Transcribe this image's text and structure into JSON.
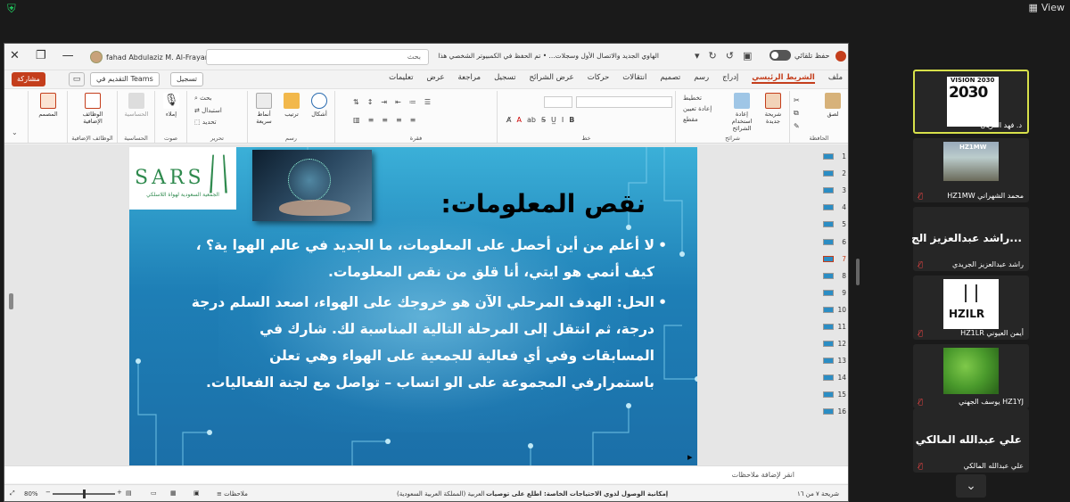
{
  "zoom": {
    "view_label": "View"
  },
  "ppt": {
    "user_name": "fahad Abdulaziz M. Al-Frayan",
    "search_placeholder": "بحث",
    "doc_title": "الهاوي الجديد والاتصال الأول وسجلات... • تم الحفظ في الكمبيوتر الشخصي هذا",
    "autosave_label": "حفظ تلقائي",
    "tabs": [
      "ملف",
      "الشريط الرئيسي",
      "إدراج",
      "رسم",
      "تصميم",
      "انتقالات",
      "حركات",
      "عرض الشرائح",
      "تسجيل",
      "مراجعة",
      "عرض",
      "تعليمات"
    ],
    "active_tab": "الشريط الرئيسي",
    "share_label": "مشاركة",
    "teams_label": "التقديم في Teams",
    "record_label": "تسجيل",
    "groups": {
      "clipboard": "الحافظة",
      "slides": "شرائح",
      "font": "خط",
      "paragraph": "فقرة",
      "drawing": "رسم",
      "editing": "تحرير",
      "voice": "صوت",
      "sensitivity": "الحساسية",
      "addins": "الوظائف الإضافية"
    },
    "buttons": {
      "paste": "لصق",
      "new_slide": "شريحة جديدة",
      "reuse_slides": "إعادة استخدام الشرائح",
      "layout": "تخطيط",
      "reset": "إعادة تعيين",
      "section": "مقطع",
      "shapes": "أشكال",
      "arrange": "ترتيب",
      "quick_styles": "أنماط سريعة",
      "find": "بحث",
      "replace": "استبدال",
      "select": "تحديد",
      "dictate": "إملاء",
      "sensitivity": "الحساسية",
      "addins": "الوظائف الإضافية",
      "designer": "المصمم"
    },
    "slide": {
      "logo_text": "SARS",
      "logo_sub": "الجمعية السعودية لهواة اللاسلكي",
      "title": "نقص المعلومات:",
      "bullets": [
        "لا أعلم من أين أحصل على المعلومات، ما الجديد في عالم الهوا ية؟ ، كيف أنمي هو ايتي، أنا قلق من نقص المعلومات.",
        "الحل: الهدف المرحلي الآن هو خروجك على الهواء، اصعد السلم درجة درجة، ثم انتقل إلى المرحلة التالية المناسبة لك. شارك في المسابقات وفي أي فعالية للجمعية على الهواء وهي تعلن باستمرارفي المجموعة على الو اتساب – تواصل مع لجنة الفعاليات."
      ]
    },
    "thumbnails": [
      "1",
      "2",
      "3",
      "4",
      "5",
      "6",
      "7",
      "8",
      "9",
      "10",
      "11",
      "12",
      "13",
      "14",
      "15",
      "16"
    ],
    "active_thumbnail": "7",
    "notes_placeholder": "انقر لإضافة ملاحظات",
    "status": {
      "slide_count": "شريحة ٧ من ١٦",
      "language": "العربية (المملكة العربية السعودية)",
      "accessibility": "إمكانية الوصول لذوي الاحتياجات الخاصة: اطلع على توصيات",
      "notes_label": "ملاحظات",
      "zoom": "80%"
    }
  },
  "participants": [
    {
      "name": "د. فهد الفريان",
      "active": true,
      "logo": "VISION 2030"
    },
    {
      "name": "محمد الشهراني HZ1MW",
      "logo": "HZ1MW"
    },
    {
      "name": "راشد عبدالعزيز الجريدي",
      "big": "...راشد عبدالعزيز الج"
    },
    {
      "name": "أيمن العيوني HZ1LR",
      "logo": "HZILR"
    },
    {
      "name": "HZ1YJ يوسف الجهني"
    },
    {
      "name": "علي عبدالله المالكي",
      "big": "علي عبدالله المالكي"
    }
  ]
}
